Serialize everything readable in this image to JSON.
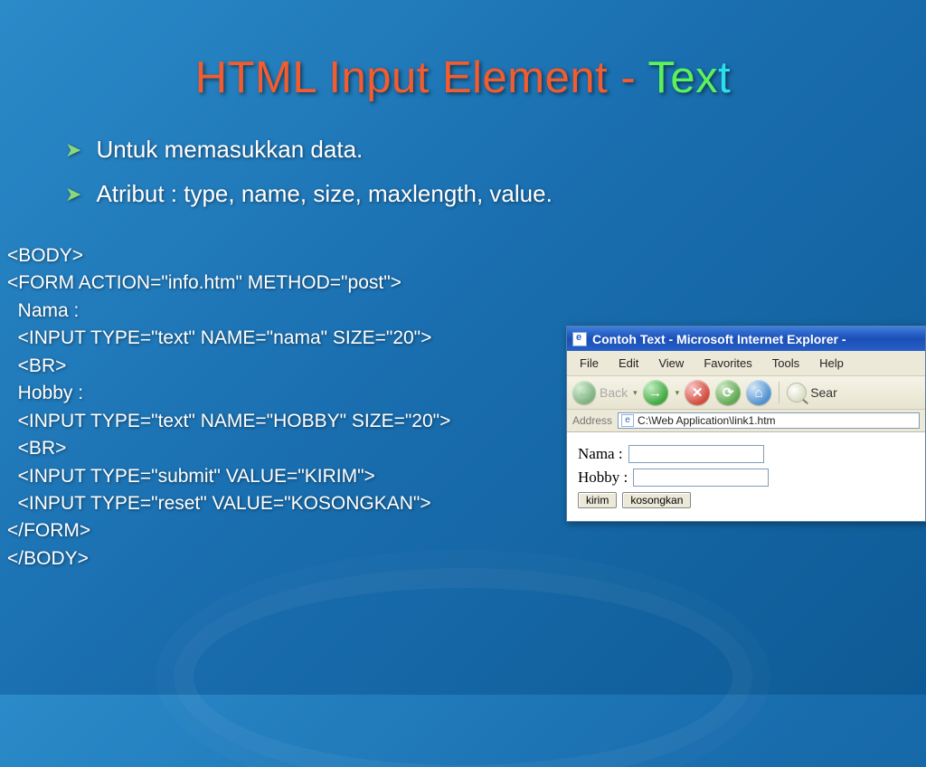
{
  "title": {
    "part1": "HTML Input Element - ",
    "part2_green": "Tex",
    "part2_cyan": "t"
  },
  "bullets": [
    "Untuk memasukkan data.",
    "Atribut : type, name, size, maxlength, value."
  ],
  "code": "<BODY>\n<FORM ACTION=\"info.htm\" METHOD=\"post\">\n  Nama :\n  <INPUT TYPE=\"text\" NAME=\"nama\" SIZE=\"20\">\n  <BR>\n  Hobby :\n  <INPUT TYPE=\"text\" NAME=\"HOBBY\" SIZE=\"20\">\n  <BR>\n  <INPUT TYPE=\"submit\" VALUE=\"KIRIM\">\n  <INPUT TYPE=\"reset\" VALUE=\"KOSONGKAN\">\n</FORM>\n</BODY>",
  "ie": {
    "title": "Contoh Text - Microsoft Internet Explorer -",
    "menus": [
      "File",
      "Edit",
      "View",
      "Favorites",
      "Tools",
      "Help"
    ],
    "back": "Back",
    "search": "Sear",
    "address_label": "Address",
    "address_value": "C:\\Web Application\\link1.htm",
    "form": {
      "nama_label": "Nama :",
      "hobby_label": "Hobby :",
      "submit": "kirim",
      "reset": "kosongkan"
    }
  }
}
